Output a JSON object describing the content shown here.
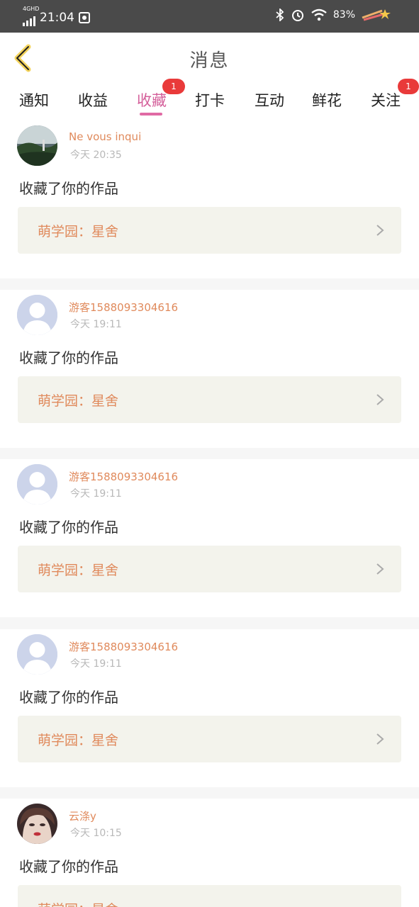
{
  "status": {
    "network": "4GHD",
    "time": "21:04",
    "battery": "83%"
  },
  "header": {
    "title": "消息"
  },
  "tabs": [
    {
      "label": "通知"
    },
    {
      "label": "收益"
    },
    {
      "label": "收藏",
      "badge": "1"
    },
    {
      "label": "打卡"
    },
    {
      "label": "互动"
    },
    {
      "label": "鲜花"
    },
    {
      "label": "关注",
      "badge": "1"
    }
  ],
  "messages": [
    {
      "user": "Ne vous inqui",
      "time": "今天 20:35",
      "action": "收藏了你的作品",
      "work": "萌学园：星舍",
      "avatar": "landscape"
    },
    {
      "user": "游客1588093304616",
      "time": "今天 19:11",
      "action": "收藏了你的作品",
      "work": "萌学园：星舍",
      "avatar": "default"
    },
    {
      "user": "游客1588093304616",
      "time": "今天 19:11",
      "action": "收藏了你的作品",
      "work": "萌学园：星舍",
      "avatar": "default"
    },
    {
      "user": "游客1588093304616",
      "time": "今天 19:11",
      "action": "收藏了你的作品",
      "work": "萌学园：星舍",
      "avatar": "default"
    },
    {
      "user": "云涤y",
      "time": "今天 10:15",
      "action": "收藏了你的作品",
      "work": "萌学园：星舍",
      "avatar": "portrait"
    }
  ],
  "colors": {
    "accent": "#d45f9a",
    "username": "#e08a5c",
    "badge": "#e93a3a"
  }
}
